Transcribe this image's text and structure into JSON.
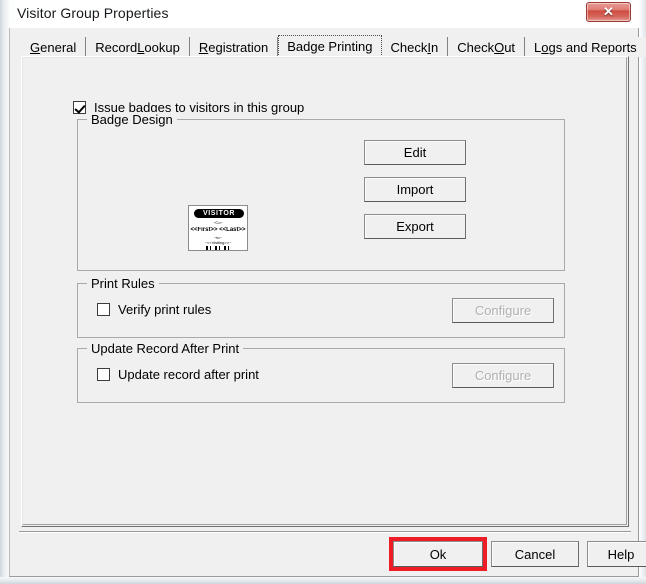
{
  "window": {
    "title": "Visitor Group Properties",
    "close_label": "✕",
    "close_icon": "close-icon"
  },
  "tabs": [
    {
      "label": "General",
      "mnemonic": "G",
      "selected": false
    },
    {
      "label": "Record Lookup",
      "mnemonic": "L",
      "selected": false
    },
    {
      "label": "Registration",
      "mnemonic": "R",
      "selected": false
    },
    {
      "label": "Badge Printing",
      "mnemonic": "",
      "selected": true
    },
    {
      "label": "Check In",
      "mnemonic": "I",
      "selected": false
    },
    {
      "label": "Check Out",
      "mnemonic": "O",
      "selected": false
    },
    {
      "label": "Logs and Reports",
      "mnemonic": "o",
      "selected": false
    }
  ],
  "page": {
    "issue_badges": {
      "label": "Issue badges to visitors in this group",
      "checked": true
    },
    "badge_design": {
      "title": "Badge Design",
      "buttons": [
        {
          "label": "Edit",
          "disabled": false
        },
        {
          "label": "Import",
          "disabled": false
        },
        {
          "label": "Export",
          "disabled": false
        }
      ],
      "preview": {
        "banner": "VISITOR",
        "line1": "~Co~",
        "line2": "<<First>> <<Last>>",
        "line3": "~to~",
        "line4": "~<<Visiting>>~",
        "barcode": "barcode"
      }
    },
    "print_rules": {
      "title": "Print Rules",
      "checkbox": {
        "label": "Verify print rules",
        "checked": false
      },
      "configure": {
        "label": "Configure",
        "disabled": true
      }
    },
    "update_record": {
      "title": "Update Record After Print",
      "checkbox": {
        "label": "Update record after print",
        "checked": false
      },
      "configure": {
        "label": "Configure",
        "disabled": true
      }
    }
  },
  "footer": {
    "ok": "Ok",
    "cancel": "Cancel",
    "help": "Help"
  },
  "annotation": {
    "highlight_color": "#ee1c25",
    "target": "ok-button"
  }
}
